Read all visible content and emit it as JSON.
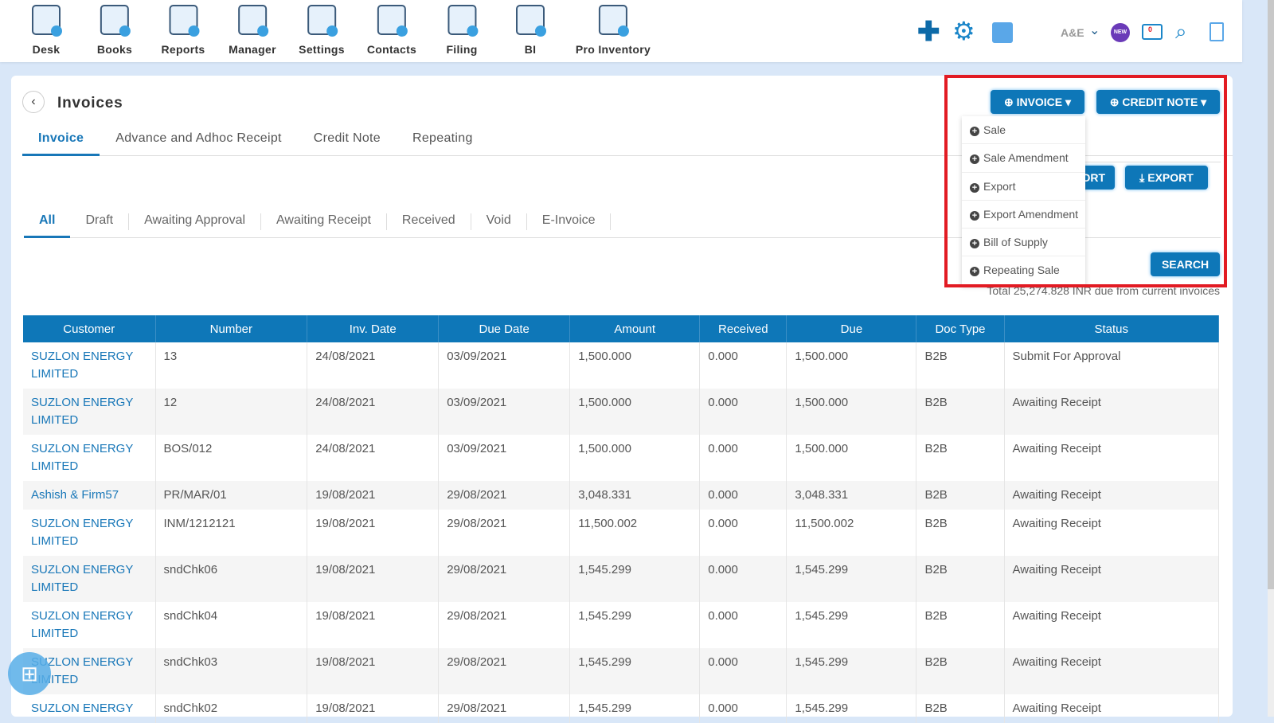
{
  "nav": [
    {
      "label": "Desk"
    },
    {
      "label": "Books"
    },
    {
      "label": "Reports"
    },
    {
      "label": "Manager"
    },
    {
      "label": "Settings"
    },
    {
      "label": "Contacts"
    },
    {
      "label": "Filing"
    },
    {
      "label": "BI"
    },
    {
      "label": "Pro Inventory"
    }
  ],
  "header": {
    "company": "A&E",
    "notification_count": "0",
    "new_badge": "NEW"
  },
  "page": {
    "title": "Invoices"
  },
  "tabs": [
    {
      "label": "Invoice"
    },
    {
      "label": "Advance and Adhoc Receipt"
    },
    {
      "label": "Credit Note"
    },
    {
      "label": "Repeating"
    }
  ],
  "subtabs": [
    {
      "label": "All"
    },
    {
      "label": "Draft"
    },
    {
      "label": "Awaiting Approval"
    },
    {
      "label": "Awaiting Receipt"
    },
    {
      "label": "Received"
    },
    {
      "label": "Void"
    },
    {
      "label": "E-Invoice"
    }
  ],
  "buttons": {
    "invoice": "INVOICE",
    "credit_note": "CREDIT NOTE",
    "import": "ORT",
    "export": "EXPORT",
    "search": "SEARCH"
  },
  "invoice_menu": [
    {
      "label": "Sale"
    },
    {
      "label": "Sale Amendment"
    },
    {
      "label": "Export"
    },
    {
      "label": "Export Amendment"
    },
    {
      "label": "Bill of Supply"
    },
    {
      "label": "Repeating Sale"
    }
  ],
  "total_text": "Total 25,274.828 INR due from current invoices",
  "table": {
    "columns": [
      "Customer",
      "Number",
      "Inv. Date",
      "Due Date",
      "Amount",
      "Received",
      "Due",
      "Doc Type",
      "Status"
    ],
    "rows": [
      [
        "SUZLON ENERGY LIMITED",
        "13",
        "24/08/2021",
        "03/09/2021",
        "1,500.000",
        "0.000",
        "1,500.000",
        "B2B",
        "Submit For Approval"
      ],
      [
        "SUZLON ENERGY LIMITED",
        "12",
        "24/08/2021",
        "03/09/2021",
        "1,500.000",
        "0.000",
        "1,500.000",
        "B2B",
        "Awaiting Receipt"
      ],
      [
        "SUZLON ENERGY LIMITED",
        "BOS/012",
        "24/08/2021",
        "03/09/2021",
        "1,500.000",
        "0.000",
        "1,500.000",
        "B2B",
        "Awaiting Receipt"
      ],
      [
        "Ashish & Firm57",
        "PR/MAR/01",
        "19/08/2021",
        "29/08/2021",
        "3,048.331",
        "0.000",
        "3,048.331",
        "B2B",
        "Awaiting Receipt"
      ],
      [
        "SUZLON ENERGY LIMITED",
        "INM/1212121",
        "19/08/2021",
        "29/08/2021",
        "11,500.002",
        "0.000",
        "11,500.002",
        "B2B",
        "Awaiting Receipt"
      ],
      [
        "SUZLON ENERGY LIMITED",
        "sndChk06",
        "19/08/2021",
        "29/08/2021",
        "1,545.299",
        "0.000",
        "1,545.299",
        "B2B",
        "Awaiting Receipt"
      ],
      [
        "SUZLON ENERGY LIMITED",
        "sndChk04",
        "19/08/2021",
        "29/08/2021",
        "1,545.299",
        "0.000",
        "1,545.299",
        "B2B",
        "Awaiting Receipt"
      ],
      [
        "SUZLON ENERGY LIMITED",
        "sndChk03",
        "19/08/2021",
        "29/08/2021",
        "1,545.299",
        "0.000",
        "1,545.299",
        "B2B",
        "Awaiting Receipt"
      ],
      [
        "SUZLON ENERGY",
        "sndChk02",
        "19/08/2021",
        "29/08/2021",
        "1,545.299",
        "0.000",
        "1,545.299",
        "B2B",
        "Awaiting Receipt"
      ]
    ]
  }
}
